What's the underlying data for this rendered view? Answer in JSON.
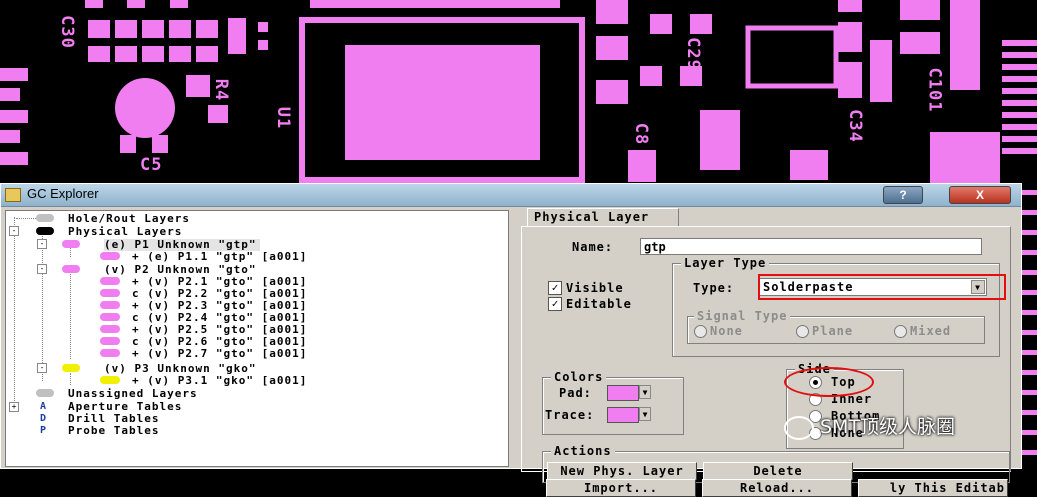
{
  "pcb": {
    "silk": [
      "C30",
      "R4",
      "U1",
      "C5",
      "C29",
      "C101",
      "C34",
      "C8"
    ]
  },
  "window": {
    "title": "GC Explorer",
    "help_label": "?",
    "close_label": "X"
  },
  "tree": {
    "hole_rout": "Hole/Rout Layers",
    "physical": "Physical Layers",
    "p1": "(e) P1 Unknown \"gtp\"",
    "p1_1": "+ (e) P1.1 \"gtp\" [a001]",
    "p2": "(v) P2 Unknown \"gto\"",
    "p2_items": [
      "+ (v) P2.1 \"gto\" [a001]",
      "c (v) P2.2 \"gto\" [a001]",
      "+ (v) P2.3 \"gto\" [a001]",
      "c (v) P2.4 \"gto\" [a001]",
      "+ (v) P2.5 \"gto\" [a001]",
      "c (v) P2.6 \"gto\" [a001]",
      "+ (v) P2.7 \"gto\" [a001]"
    ],
    "p3": "(v) P3 Unknown \"gko\"",
    "p3_1": "+ (v) P3.1 \"gko\" [a001]",
    "unassigned": "Unassigned Layers",
    "aperture": "Aperture Tables",
    "drill": "Drill Tables",
    "probe": "Probe Tables"
  },
  "panel": {
    "tab": "Physical Layer",
    "name_label": "Name:",
    "name_value": "gtp",
    "visible_label": "Visible",
    "visible_mark": "✓",
    "editable_label": "Editable",
    "editable_mark": "✓",
    "layer_type_legend": "Layer Type",
    "type_label": "Type:",
    "type_value": "Solderpaste",
    "signal_type_legend": "Signal Type",
    "signal_none": "None",
    "signal_plane": "Plane",
    "signal_mixed": "Mixed",
    "colors_legend": "Colors",
    "pad_label": "Pad:",
    "trace_label": "Trace:",
    "layer_color": "#f07ef0",
    "side_legend": "Side",
    "side_top": "Top",
    "side_inner": "Inner",
    "side_bottom": "Bottom",
    "side_none": "None",
    "actions_legend": "Actions",
    "new_phys": "New Phys. Layer",
    "delete": "Delete",
    "import": "Import...",
    "reload": "Reload...",
    "apply_this": "ly This Editab"
  },
  "watermark": "SMT顶级人脉圈"
}
